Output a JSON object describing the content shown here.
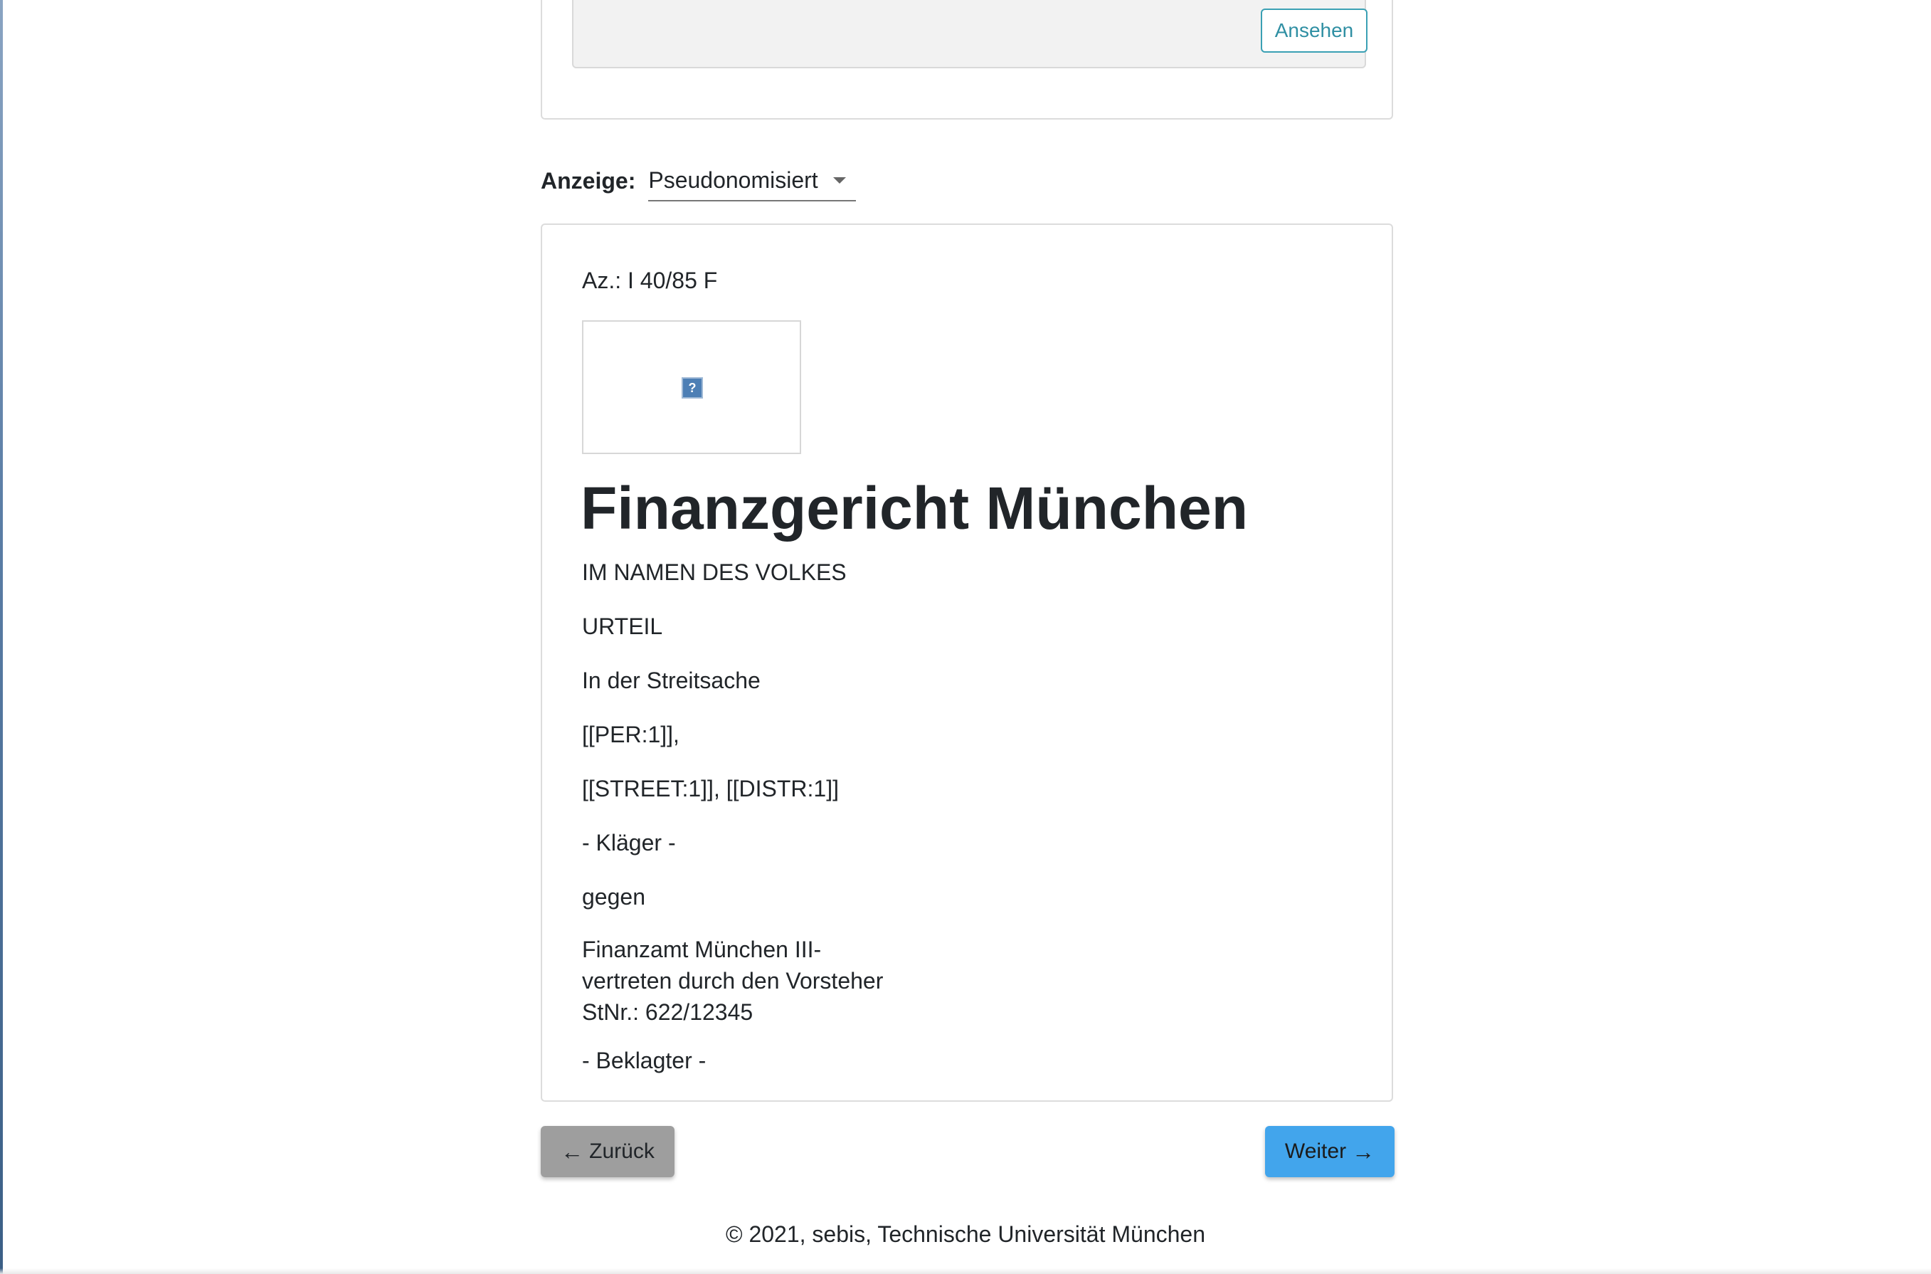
{
  "top_card": {
    "view_button_label": "Ansehen"
  },
  "display_mode": {
    "label": "Anzeige:",
    "selected_option": "Pseudonomisiert"
  },
  "document": {
    "file_number": "Az.: I 40/85 F",
    "image_placeholder_icon": "?",
    "court_title": "Finanzgericht München",
    "lines": [
      "IM NAMEN DES VOLKES",
      "URTEIL",
      "In der Streitsache",
      "[[PER:1]],",
      "[[STREET:1]], [[DISTR:1]]",
      "- Kläger -",
      "gegen"
    ],
    "defendant_block": [
      "Finanzamt München III-",
      "vertreten durch den Vorsteher",
      "StNr.: 622/12345"
    ],
    "defendant_role": "- Beklagter -"
  },
  "navigation": {
    "back_label": "Zurück",
    "next_label": "Weiter",
    "back_icon": "arrow-left-icon",
    "next_icon": "arrow-right-icon"
  },
  "footer": {
    "copyright": "© 2021, sebis, Technische Universität München"
  },
  "colors": {
    "next_button": "#42a5ec",
    "back_button": "#9e9e9e",
    "view_button_border": "#3aa0b4"
  }
}
